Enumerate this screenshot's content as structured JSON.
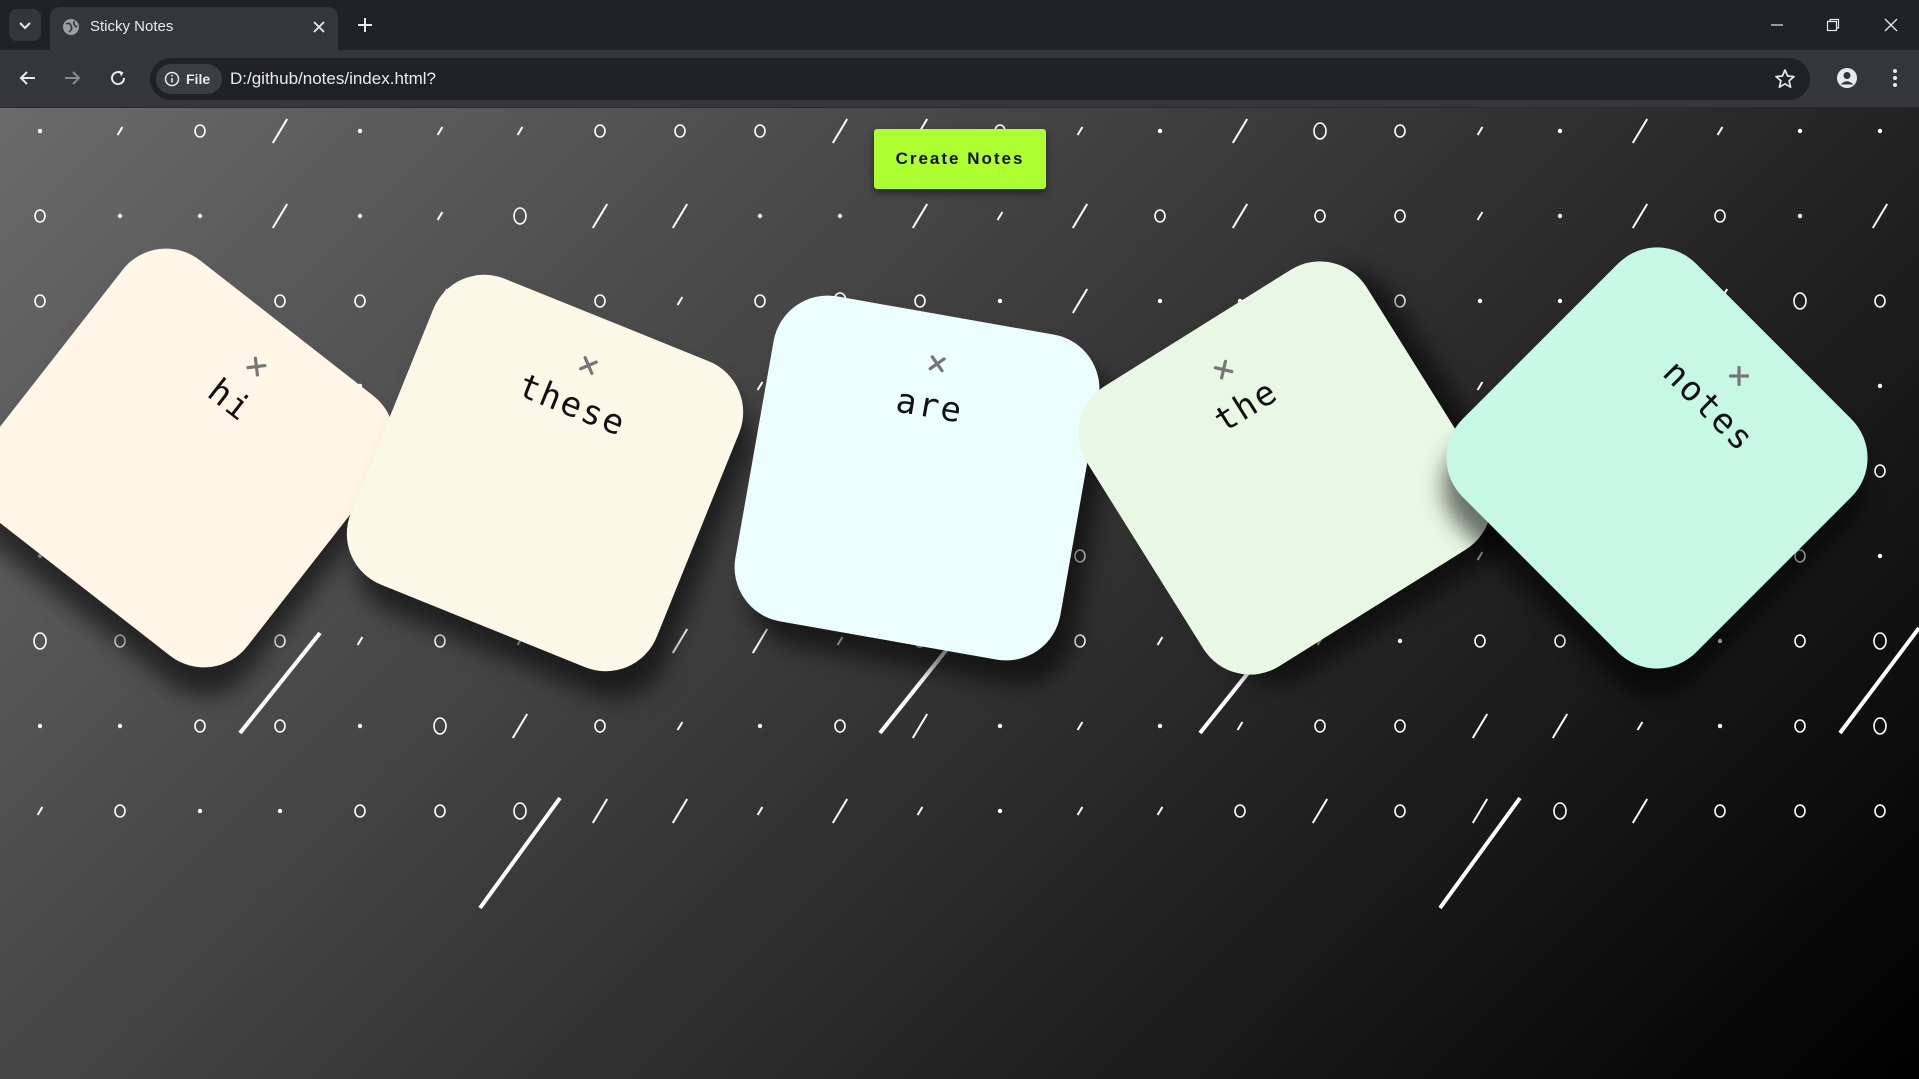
{
  "browser": {
    "tab": {
      "title": "Sticky Notes",
      "favicon": "globe-icon"
    },
    "address": {
      "security_label": "File",
      "url": "D:/github/notes/index.html?"
    }
  },
  "page": {
    "create_button_label": "Create Notes",
    "notes": [
      {
        "text": "hi",
        "color": "#fff6e8",
        "rotation_deg": 38
      },
      {
        "text": "these",
        "color": "#fbf8e8",
        "rotation_deg": 22
      },
      {
        "text": "are",
        "color": "#ebfdfc",
        "rotation_deg": 10
      },
      {
        "text": "the",
        "color": "#e9f8e4",
        "rotation_deg": -32
      },
      {
        "text": "notes",
        "color": "#c7f8e6",
        "rotation_deg": 45
      }
    ]
  },
  "colors": {
    "accent": "#adff2f",
    "close_icon": "#777777"
  }
}
